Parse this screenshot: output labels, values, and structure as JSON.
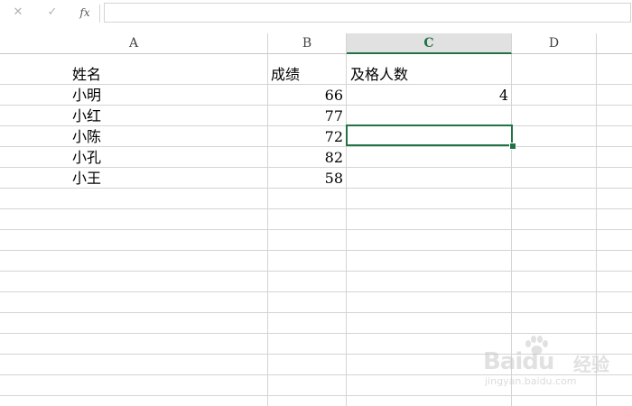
{
  "formula_bar": {
    "cancel_icon": "✕",
    "enter_icon": "✓",
    "fx_label": "fx",
    "content": ""
  },
  "columns": [
    {
      "letter": "A"
    },
    {
      "letter": "B"
    },
    {
      "letter": "C",
      "selected": true
    },
    {
      "letter": "D"
    }
  ],
  "cells": {
    "A1": "姓名",
    "B1": "成绩",
    "C1": "及格人数",
    "A2": "小明",
    "B2": "66",
    "C2": "4",
    "A3": "小红",
    "B3": "77",
    "A4": "小陈",
    "B4": "72",
    "A5": "小孔",
    "B5": "82",
    "A6": "小王",
    "B6": "58"
  },
  "active_cell": "C4",
  "colors": {
    "accent": "#217346",
    "gridline": "#d4d4d4",
    "header_selected_bg": "#e1e1e1"
  },
  "watermark": {
    "logo": "Baidu",
    "jingyan": "经验",
    "url": "jingyan.baidu.com"
  }
}
